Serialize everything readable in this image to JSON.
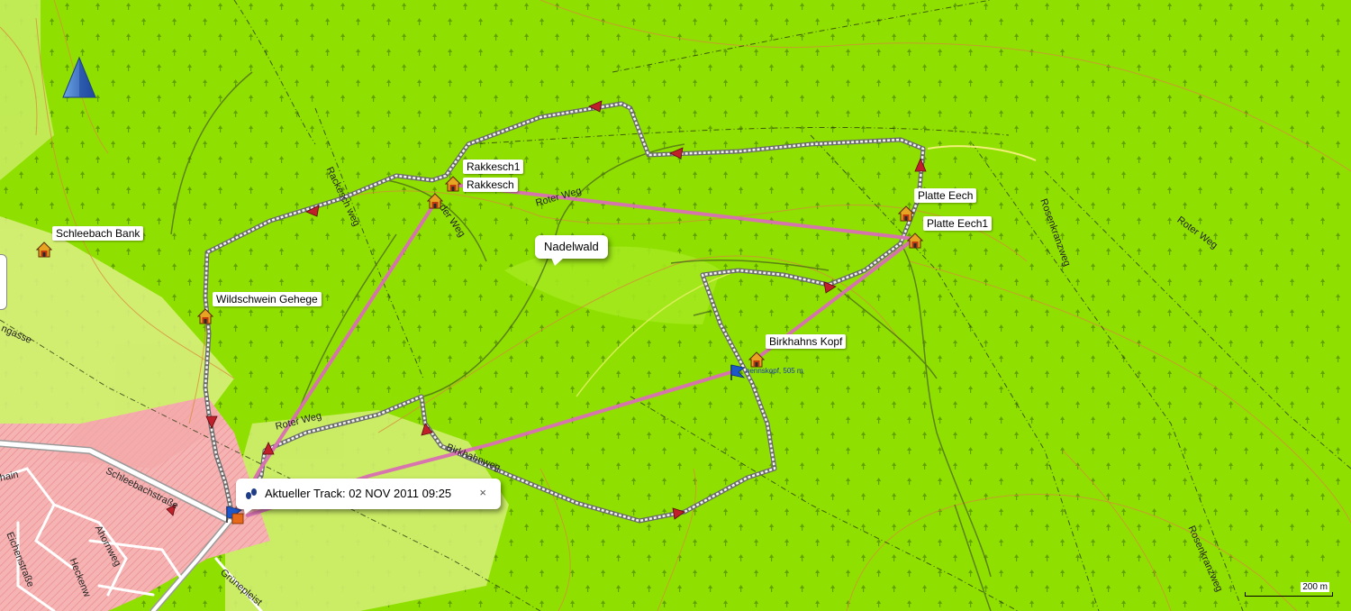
{
  "map": {
    "scale_label": "200 m",
    "track_callout": "Aktueller Track: 02 NOV 2011 09:25",
    "track_callout_close": "×",
    "area_label": "Nadelwald",
    "summit_label": "nennskopf, 505 m",
    "pois": [
      {
        "label": "Rakkesch1"
      },
      {
        "label": "Rakkesch"
      },
      {
        "label": "Schleebach Bank"
      },
      {
        "label": "Wildschwein Gehege"
      },
      {
        "label": "Platte Eech"
      },
      {
        "label": "Platte Eech1"
      },
      {
        "label": "Birkhahns Kopf"
      }
    ],
    "roads": [
      {
        "label": "Rackesch weg"
      },
      {
        "label": "Roter Weg"
      },
      {
        "label": "Roter Weg"
      },
      {
        "label": "Roter Weg"
      },
      {
        "label": "Rosenkranzweg"
      },
      {
        "label": "Rosenkranzweg"
      },
      {
        "label": "Birkhahnweg"
      },
      {
        "label": "Schleebachstraße"
      },
      {
        "label": "Ahornweg"
      },
      {
        "label": "Eichenstraße"
      },
      {
        "label": "Heckenw"
      },
      {
        "label": "Grünepleist"
      },
      {
        "label": "ngasse"
      },
      {
        "label": "hain"
      },
      {
        "label": "der Weg"
      }
    ],
    "colors": {
      "forest": "#8fe000",
      "urban": "#f4a8a8",
      "meadow": "#d9ef7c",
      "route": "#d96fb4",
      "contour": "#d88a3c"
    },
    "icons": [
      "north-arrow-icon",
      "house-poi-icon",
      "flag-icon",
      "footprints-icon",
      "direction-arrow-icon"
    ]
  }
}
